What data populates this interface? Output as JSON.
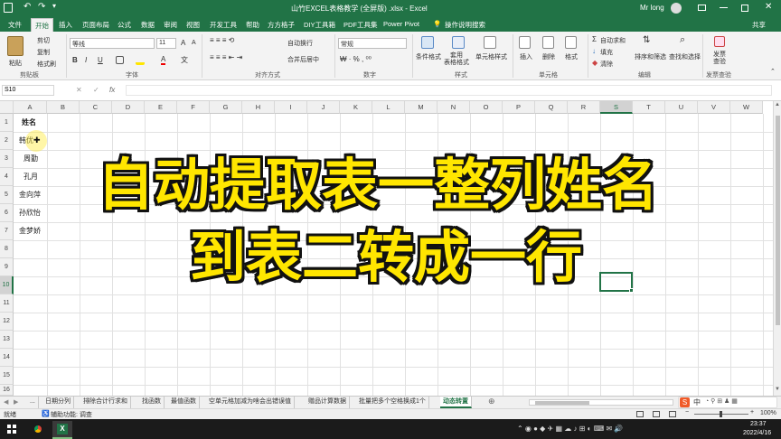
{
  "titlebar": {
    "title": "山竹EXCEL表格教学 (全屏版) .xlsx - Excel",
    "user": "Mr long",
    "search_placeholder": "搜索"
  },
  "tabs": [
    "文件",
    "开始",
    "插入",
    "页面布局",
    "公式",
    "数据",
    "审阅",
    "视图",
    "开发工具",
    "帮助",
    "方方格子",
    "DIY工具箱",
    "PDF工具集",
    "Power Pivot",
    "操作说明搜索"
  ],
  "share": "共享",
  "ribbon": {
    "clipboard": {
      "paste": "粘贴",
      "cut": "剪切",
      "copy": "复制",
      "format_painter": "格式刷",
      "label": "剪贴板"
    },
    "font": {
      "name": "等线",
      "size": "11",
      "bold": "B",
      "italic": "I",
      "underline": "U",
      "grow": "A",
      "shrink": "A",
      "font_color": "A",
      "label": "字体"
    },
    "alignment": {
      "wrap": "自动换行",
      "merge": "合并后居中",
      "label": "对齐方式"
    },
    "number": {
      "format": "常规",
      "label": "数字"
    },
    "styles": {
      "conditional": "条件格式",
      "table": "套用\n表格格式",
      "cell": "单元格样式",
      "label": "样式"
    },
    "cells": {
      "insert": "插入",
      "delete": "删除",
      "format": "格式",
      "label": "单元格"
    },
    "editing": {
      "autosum": "自动求和",
      "fill": "填充",
      "clear": "清除",
      "sort": "排序和筛选",
      "find": "查找和选择",
      "label": "编辑"
    },
    "invoice": {
      "check": "发票\n查验",
      "label": "发票查验"
    }
  },
  "formula_bar": {
    "name_box": "S10",
    "fx": "fx",
    "value": ""
  },
  "grid": {
    "columns": [
      "A",
      "B",
      "C",
      "D",
      "E",
      "F",
      "G",
      "H",
      "I",
      "J",
      "K",
      "L",
      "M",
      "N",
      "O",
      "P",
      "Q",
      "R",
      "S",
      "T",
      "U",
      "V",
      "W"
    ],
    "rows": [
      "1",
      "2",
      "3",
      "4",
      "5",
      "6",
      "7",
      "8",
      "9",
      "10",
      "11",
      "12",
      "13",
      "14",
      "15",
      "16"
    ],
    "cells": {
      "A1": "姓名",
      "A2": "韩优",
      "A3": "周勤",
      "A4": "孔月",
      "A5": "金向萍",
      "A6": "孙欣怡",
      "A7": "金梦娇"
    },
    "selected_cell": "S10"
  },
  "overlay": {
    "line1": "自动提取表一整列姓名",
    "line2": "到表二转成一行"
  },
  "sheet_tabs": [
    "...",
    "日期分列",
    "排除合计行求和",
    "找函数",
    "最值函数",
    "空单元格加减为啥会出错误值",
    "赠品计算数据",
    "批量把多个空格换成1个",
    "动态转置"
  ],
  "active_sheet": "动态转置",
  "status": {
    "ready": "就绪",
    "accessibility": "辅助功能: 调查",
    "zoom": "100%"
  },
  "ime": {
    "label": "中"
  },
  "taskbar": {
    "time": "23:37",
    "date": "2022/4/16"
  },
  "colors": {
    "excel_green": "#217346",
    "overlay_fill": "#ffe600",
    "overlay_stroke": "#111111"
  }
}
